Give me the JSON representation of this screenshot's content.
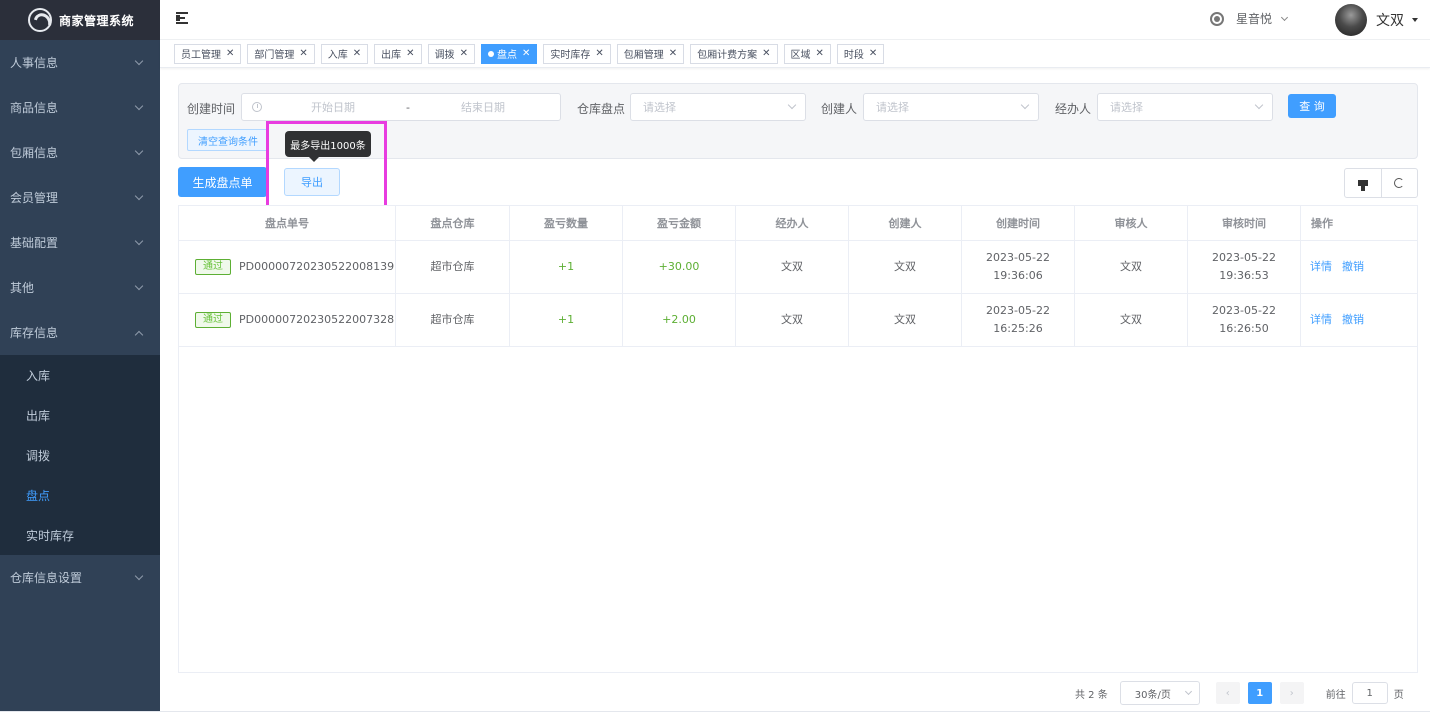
{
  "app": {
    "title": "商家管理系统"
  },
  "sidebar": {
    "items": [
      {
        "label": "人事信息"
      },
      {
        "label": "商品信息"
      },
      {
        "label": "包厢信息"
      },
      {
        "label": "会员管理"
      },
      {
        "label": "基础配置"
      },
      {
        "label": "其他"
      },
      {
        "label": "库存信息"
      }
    ],
    "subitems": [
      {
        "label": "入库"
      },
      {
        "label": "出库"
      },
      {
        "label": "调拨"
      },
      {
        "label": "盘点"
      },
      {
        "label": "实时库存"
      }
    ],
    "last_item": "仓库信息设置"
  },
  "header": {
    "store_name": "星音悦",
    "user_name": "文双"
  },
  "tags": [
    {
      "label": "员工管理"
    },
    {
      "label": "部门管理"
    },
    {
      "label": "入库"
    },
    {
      "label": "出库"
    },
    {
      "label": "调拨"
    },
    {
      "label": "盘点"
    },
    {
      "label": "实时库存"
    },
    {
      "label": "包厢管理"
    },
    {
      "label": "包厢计费方案"
    },
    {
      "label": "区域"
    },
    {
      "label": "时段"
    }
  ],
  "search": {
    "created_time_label": "创建时间",
    "start_placeholder": "开始日期",
    "separator": "-",
    "end_placeholder": "结束日期",
    "warehouse_label": "仓库盘点",
    "warehouse_placeholder": "请选择",
    "creator_label": "创建人",
    "creator_placeholder": "请选择",
    "handler_label": "经办人",
    "handler_placeholder": "请选择",
    "query_button": "查 询",
    "clear_button": "清空查询条件"
  },
  "toolbar": {
    "generate_button": "生成盘点单",
    "export_button": "导出",
    "export_tooltip": "最多导出1000条"
  },
  "table": {
    "headers": [
      "盘点单号",
      "盘点仓库",
      "盈亏数量",
      "盈亏金额",
      "经办人",
      "创建人",
      "创建时间",
      "审核人",
      "审核时间",
      "操作"
    ],
    "rows": [
      {
        "status": "通过",
        "order_no": "PD00000720230522008139",
        "warehouse": "超市仓库",
        "qty": "+1",
        "amount": "+30.00",
        "handler": "文双",
        "creator": "文双",
        "created_time": "2023-05-22 19:36:06",
        "reviewer": "文双",
        "review_time": "2023-05-22 19:36:53",
        "detail": "详情",
        "revoke": "撤销"
      },
      {
        "status": "通过",
        "order_no": "PD00000720230522007328",
        "warehouse": "超市仓库",
        "qty": "+1",
        "amount": "+2.00",
        "handler": "文双",
        "creator": "文双",
        "created_time": "2023-05-22 16:25:26",
        "reviewer": "文双",
        "review_time": "2023-05-22 16:26:50",
        "detail": "详情",
        "revoke": "撤销"
      }
    ]
  },
  "pagination": {
    "total": "共 2 条",
    "page_size": "30条/页",
    "prev": "‹",
    "current": "1",
    "next": "›",
    "goto_label": "前往",
    "goto_value": "1",
    "page_suffix": "页"
  },
  "colors": {
    "primary": "#409eff",
    "sidebar": "#304156",
    "success": "#67c23a",
    "highlight": "#e83ce0"
  }
}
